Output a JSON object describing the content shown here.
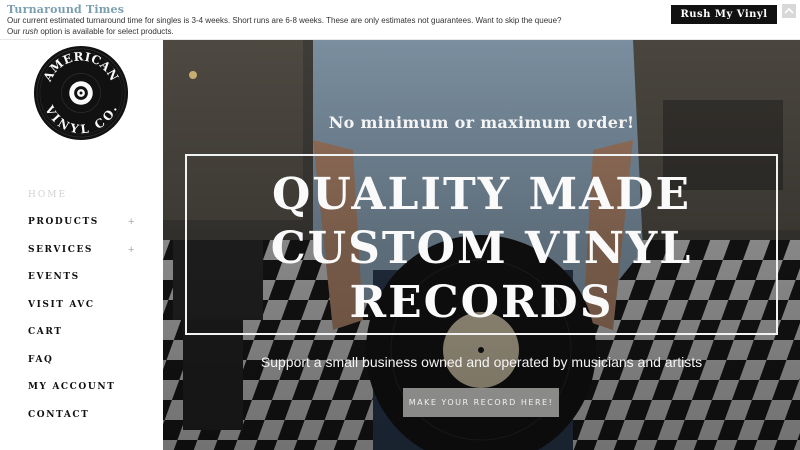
{
  "notice": {
    "title": "Turnaround Times",
    "text_before": "Our current estimated turnaround time for singles is 3-4 weeks. Short runs are 6-8 weeks. These are only estimates not guarantees. Want to skip the queue? Our ",
    "text_em": "rush",
    "text_after": " option is available for select products.",
    "button_label": "Rush My Vinyl",
    "scroll_icon": "chevron-up-icon"
  },
  "logo": {
    "line1": "AMERICAN",
    "line2": "VINYL CO."
  },
  "nav": {
    "items": [
      {
        "label": "HOME",
        "has_submenu": false
      },
      {
        "label": "PRODUCTS",
        "has_submenu": true
      },
      {
        "label": "SERVICES",
        "has_submenu": true
      },
      {
        "label": "EVENTS",
        "has_submenu": false
      },
      {
        "label": "VISIT AVC",
        "has_submenu": false
      },
      {
        "label": "CART",
        "has_submenu": false
      },
      {
        "label": "FAQ",
        "has_submenu": false
      },
      {
        "label": "MY ACCOUNT",
        "has_submenu": false
      },
      {
        "label": "CONTACT",
        "has_submenu": false
      }
    ],
    "expand_symbol": "+"
  },
  "hero": {
    "kicker": "No minimum or maximum order!",
    "title_line1": "QUALITY MADE",
    "title_line2": "CUSTOM VINYL",
    "title_line3": "RECORDS",
    "subtitle": "Support a small business owned and operated by musicians and artists",
    "cta_label": "MAKE YOUR RECORD HERE!"
  },
  "colors": {
    "notice_title": "#7aa0b0",
    "button_dark": "#111111",
    "cta_bg": "#8a8a88",
    "nav_home": "#d2d2d2"
  }
}
